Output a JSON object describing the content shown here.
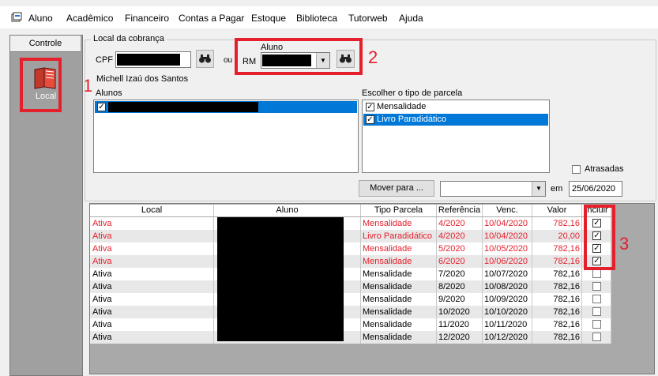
{
  "menu": {
    "items": [
      "Aluno",
      "Acadêmico",
      "Financeiro",
      "Contas a Pagar",
      "Estoque",
      "Biblioteca",
      "Tutorweb",
      "Ajuda"
    ]
  },
  "sidebar": {
    "header": "Controle",
    "button_label": "Local"
  },
  "form": {
    "group_title": "Local da cobrança",
    "cpf_label": "CPF",
    "or_label": "ou",
    "aluno_label": "Aluno",
    "rm_label": "RM",
    "student_name": "Michell Izaú dos Santos",
    "alunos_label": "Alunos",
    "parcela_type_label": "Escolher o tipo de parcela",
    "parcela_types": [
      {
        "label": "Mensalidade",
        "checked": true,
        "selected": false
      },
      {
        "label": "Livro Paradidático",
        "checked": true,
        "selected": true
      }
    ],
    "atrasadas_label": "Atrasadas",
    "mover_button": "Mover para ...",
    "em_label": "em",
    "date_value": "25/06/2020"
  },
  "annotations": {
    "n1": "1",
    "n2": "2",
    "n3": "3"
  },
  "table": {
    "columns": [
      "Local",
      "Aluno",
      "Tipo Parcela",
      "Referência",
      "Venc.",
      "Valor",
      "Incluir"
    ],
    "rows": [
      {
        "local": "Ativa",
        "tipo": "Mensalidade",
        "ref": "4/2020",
        "venc": "10/04/2020",
        "valor": "782,16",
        "incluir": true,
        "red": true
      },
      {
        "local": "Ativa",
        "tipo": "Livro Paradidático",
        "ref": "4/2020",
        "venc": "10/04/2020",
        "valor": "20,00",
        "incluir": true,
        "red": true
      },
      {
        "local": "Ativa",
        "tipo": "Mensalidade",
        "ref": "5/2020",
        "venc": "10/05/2020",
        "valor": "782,16",
        "incluir": true,
        "red": true
      },
      {
        "local": "Ativa",
        "tipo": "Mensalidade",
        "ref": "6/2020",
        "venc": "10/06/2020",
        "valor": "782,16",
        "incluir": true,
        "red": true
      },
      {
        "local": "Ativa",
        "tipo": "Mensalidade",
        "ref": "7/2020",
        "venc": "10/07/2020",
        "valor": "782,16",
        "incluir": false,
        "red": false
      },
      {
        "local": "Ativa",
        "tipo": "Mensalidade",
        "ref": "8/2020",
        "venc": "10/08/2020",
        "valor": "782,16",
        "incluir": false,
        "red": false
      },
      {
        "local": "Ativa",
        "tipo": "Mensalidade",
        "ref": "9/2020",
        "venc": "10/09/2020",
        "valor": "782,16",
        "incluir": false,
        "red": false
      },
      {
        "local": "Ativa",
        "tipo": "Mensalidade",
        "ref": "10/2020",
        "venc": "10/10/2020",
        "valor": "782,16",
        "incluir": false,
        "red": false
      },
      {
        "local": "Ativa",
        "tipo": "Mensalidade",
        "ref": "11/2020",
        "venc": "10/11/2020",
        "valor": "782,16",
        "incluir": false,
        "red": false
      },
      {
        "local": "Ativa",
        "tipo": "Mensalidade",
        "ref": "12/2020",
        "venc": "10/12/2020",
        "valor": "782,16",
        "incluir": false,
        "red": false
      }
    ]
  },
  "colors": {
    "accent_red": "#e5202d",
    "selection_blue": "#0078d7"
  }
}
